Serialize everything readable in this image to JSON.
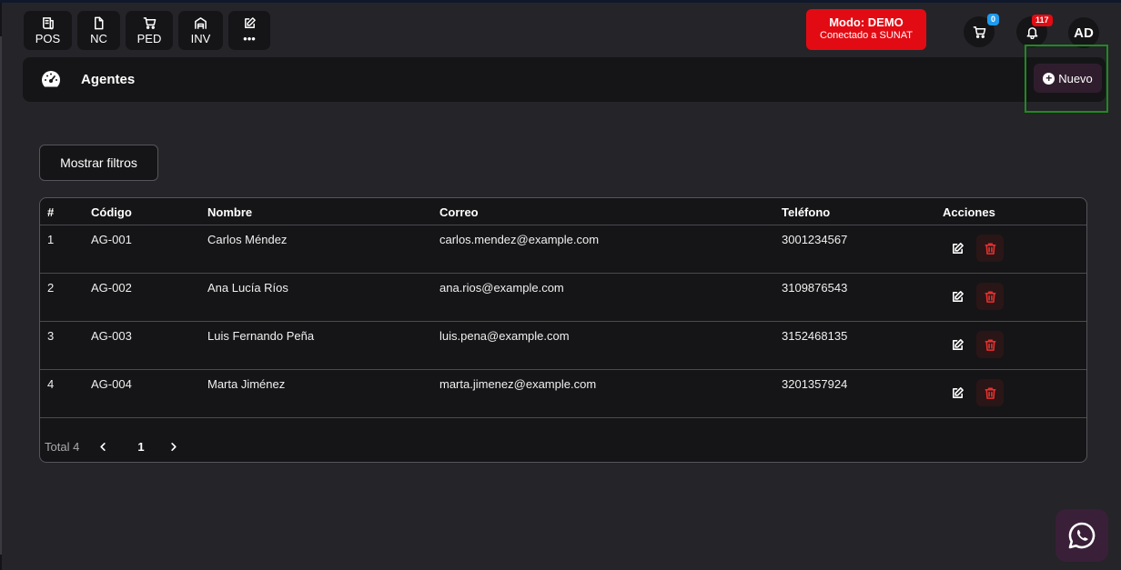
{
  "toolbar": {
    "items": [
      {
        "label": "POS",
        "icon": "receipt-icon"
      },
      {
        "label": "NC",
        "icon": "document-icon"
      },
      {
        "label": "PED",
        "icon": "cart-icon"
      },
      {
        "label": "INV",
        "icon": "warehouse-icon"
      },
      {
        "label": "•••",
        "icon": "edit-icon"
      }
    ]
  },
  "status": {
    "mode": "Modo: DEMO",
    "connection": "Conectado a SUNAT",
    "color": "#e30b13"
  },
  "cart": {
    "count": "0",
    "badge_color": "#1e9bf0"
  },
  "notifications": {
    "count": "117",
    "badge_color": "#e30b13"
  },
  "user": {
    "initials": "AD"
  },
  "header": {
    "title": "Agentes",
    "icon": "dashboard-icon",
    "new_button": "Nuevo"
  },
  "filters": {
    "toggle_label": "Mostrar filtros"
  },
  "table": {
    "columns": [
      "#",
      "Código",
      "Nombre",
      "Correo",
      "Teléfono",
      "Acciones"
    ],
    "rows": [
      {
        "num": "1",
        "code": "AG-001",
        "name": "Carlos Méndez",
        "email": "carlos.mendez@example.com",
        "phone": "3001234567"
      },
      {
        "num": "2",
        "code": "AG-002",
        "name": "Ana Lucía Ríos",
        "email": "ana.rios@example.com",
        "phone": "3109876543"
      },
      {
        "num": "3",
        "code": "AG-003",
        "name": "Luis Fernando Peña",
        "email": "luis.pena@example.com",
        "phone": "3152468135"
      },
      {
        "num": "4",
        "code": "AG-004",
        "name": "Marta Jiménez",
        "email": "marta.jimenez@example.com",
        "phone": "3201357924"
      }
    ]
  },
  "pagination": {
    "total": "Total 4",
    "current_page": "1"
  },
  "accent_colors": {
    "danger": "#e5312f",
    "primary_dark": "#2f1d2e"
  }
}
